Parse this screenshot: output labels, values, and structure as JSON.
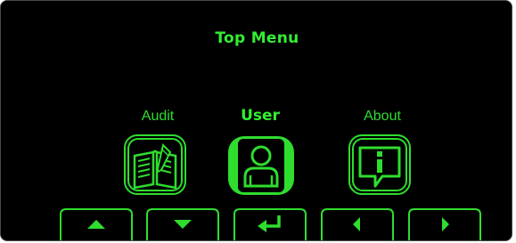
{
  "screen": {
    "title": "Top Menu"
  },
  "menu": {
    "items": [
      {
        "label": "Audit",
        "icon": "audit-book-icon",
        "selected": false
      },
      {
        "label": "User",
        "icon": "user-icon",
        "selected": true
      },
      {
        "label": "About",
        "icon": "about-info-icon",
        "selected": false
      }
    ]
  },
  "nav": {
    "buttons": [
      {
        "icon": "arrow-up-icon"
      },
      {
        "icon": "arrow-down-icon"
      },
      {
        "icon": "enter-return-icon"
      },
      {
        "icon": "arrow-left-icon"
      },
      {
        "icon": "arrow-right-icon"
      }
    ]
  },
  "colors": {
    "background": "#000000",
    "accent": "#33ee33",
    "frame": "#4a4a4a"
  }
}
